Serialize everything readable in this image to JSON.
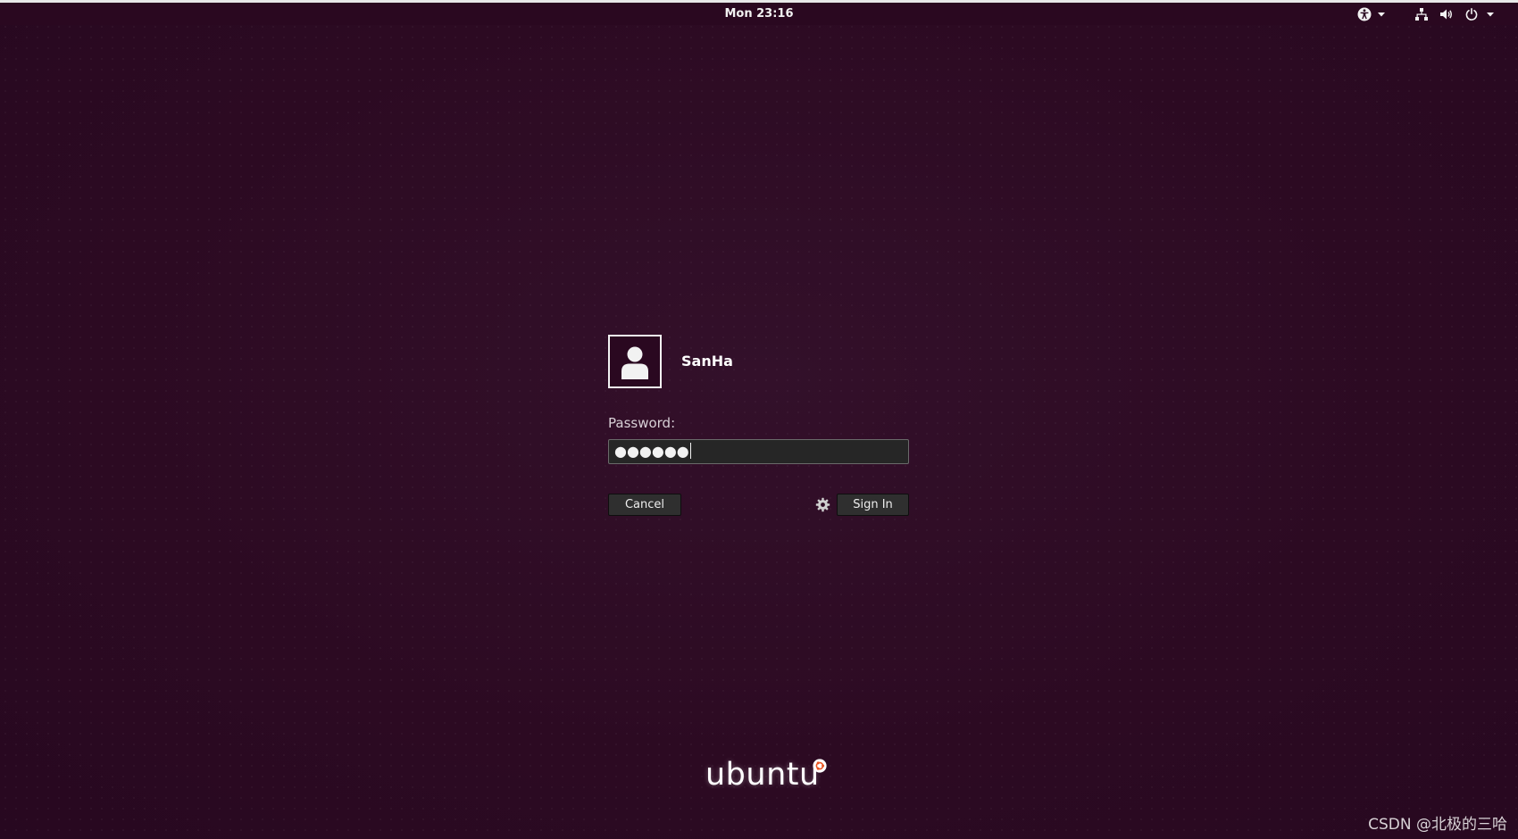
{
  "top_panel": {
    "clock": "Mon 23:16",
    "indicators": [
      "accessibility-icon",
      "network-icon",
      "volume-icon",
      "power-icon"
    ]
  },
  "login": {
    "username": "SanHa",
    "password_label": "Password:",
    "password_value": "●●●●●●",
    "cancel_label": "Cancel",
    "sign_in_label": "Sign In",
    "session_icon": "gear-icon"
  },
  "branding": {
    "logo_text": "ubuntu",
    "accent_color": "#e95420"
  },
  "watermark": "CSDN @北极的三哈",
  "colors": {
    "background": "#2c0a22",
    "panel": "#2a0820",
    "field": "#262626",
    "button": "#2f2f2f"
  }
}
